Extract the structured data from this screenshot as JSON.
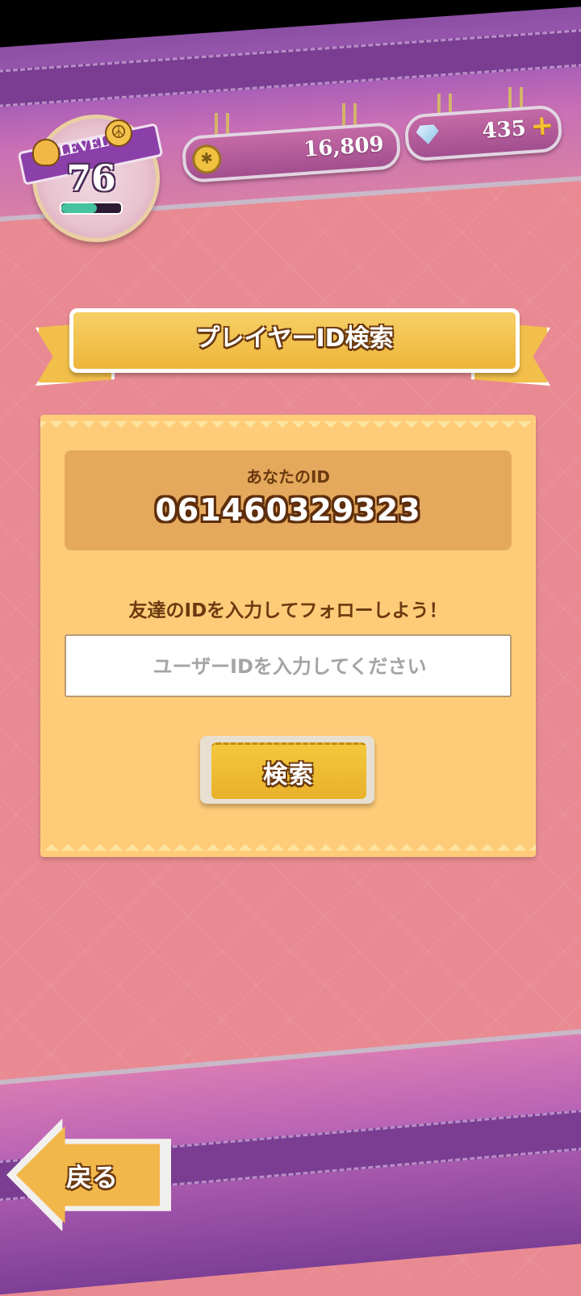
{
  "header": {
    "level_label": "LEVEL",
    "level_value": "76",
    "level_progress": 0.6,
    "coins": "16,809",
    "gems": "435"
  },
  "title": "プレイヤーID検索",
  "panel": {
    "your_id_label": "あなたのID",
    "your_id_value": "061460329323",
    "prompt": "友達のIDを入力してフォローしよう！",
    "input_placeholder": "ユーザーIDを入力してください",
    "input_value": "",
    "search_button": "検索"
  },
  "footer": {
    "back_button": "戻る"
  },
  "colors": {
    "background": "#e98a92",
    "panel": "#fecc79",
    "id_box": "#e5a95d",
    "accent_gold": "#f2bf4a",
    "text_brown": "#6b3a10",
    "purple_band": "#8b4fa3"
  },
  "icons": {
    "level": "hand-icon",
    "peace": "peace-icon",
    "coin": "coin-icon",
    "gem": "gem-icon",
    "add": "plus-icon",
    "back": "back-arrow-icon"
  }
}
